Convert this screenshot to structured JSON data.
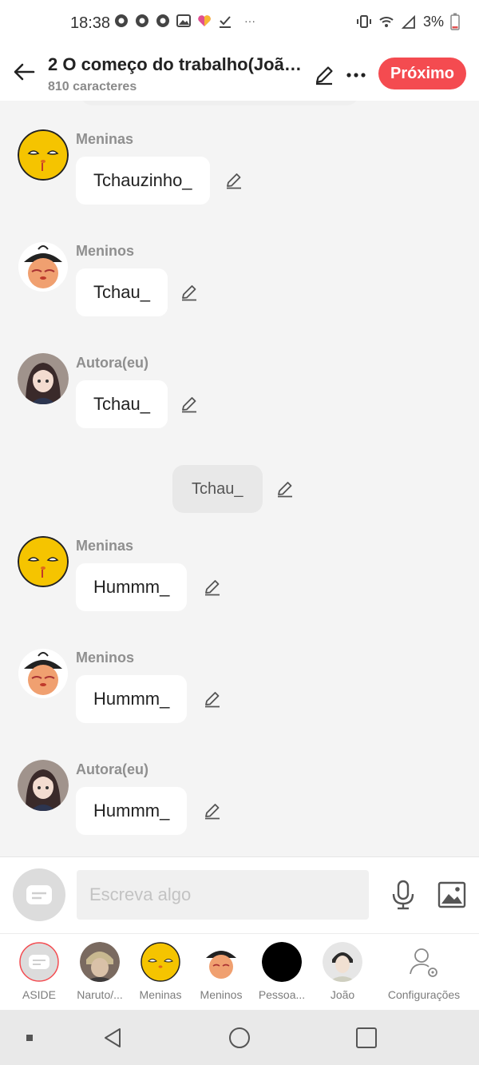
{
  "status_bar": {
    "time": "18:38",
    "battery": "3%",
    "overflow": "···"
  },
  "header": {
    "title": "2 O começo do trabalho(Joã…",
    "subtitle": "810 caracteres",
    "next_label": "Próximo"
  },
  "messages": [
    {
      "sender": "Meninas",
      "text": "Tchauzinho_",
      "avatar": "yellow-chick"
    },
    {
      "sender": "Meninos",
      "text": "Tchau_",
      "avatar": "orange-chick"
    },
    {
      "sender": "Autora(eu)",
      "text": "Tchau_",
      "avatar": "anime-girl"
    },
    {
      "sender": "Meninas",
      "text": "Hummm_",
      "avatar": "yellow-chick"
    },
    {
      "sender": "Meninos",
      "text": "Hummm_",
      "avatar": "orange-chick"
    },
    {
      "sender": "Autora(eu)",
      "text": "Hummm_",
      "avatar": "anime-girl"
    }
  ],
  "narration": {
    "text": "Tchau_"
  },
  "composer": {
    "placeholder": "Escreva algo"
  },
  "characters": [
    {
      "label": "ASIDE"
    },
    {
      "label": "Naruto/..."
    },
    {
      "label": "Meninas"
    },
    {
      "label": "Meninos"
    },
    {
      "label": "Pessoa..."
    },
    {
      "label": "João"
    },
    {
      "label": "Configurações"
    }
  ],
  "colors": {
    "accent": "#f44b50",
    "background": "#f4f4f4"
  }
}
